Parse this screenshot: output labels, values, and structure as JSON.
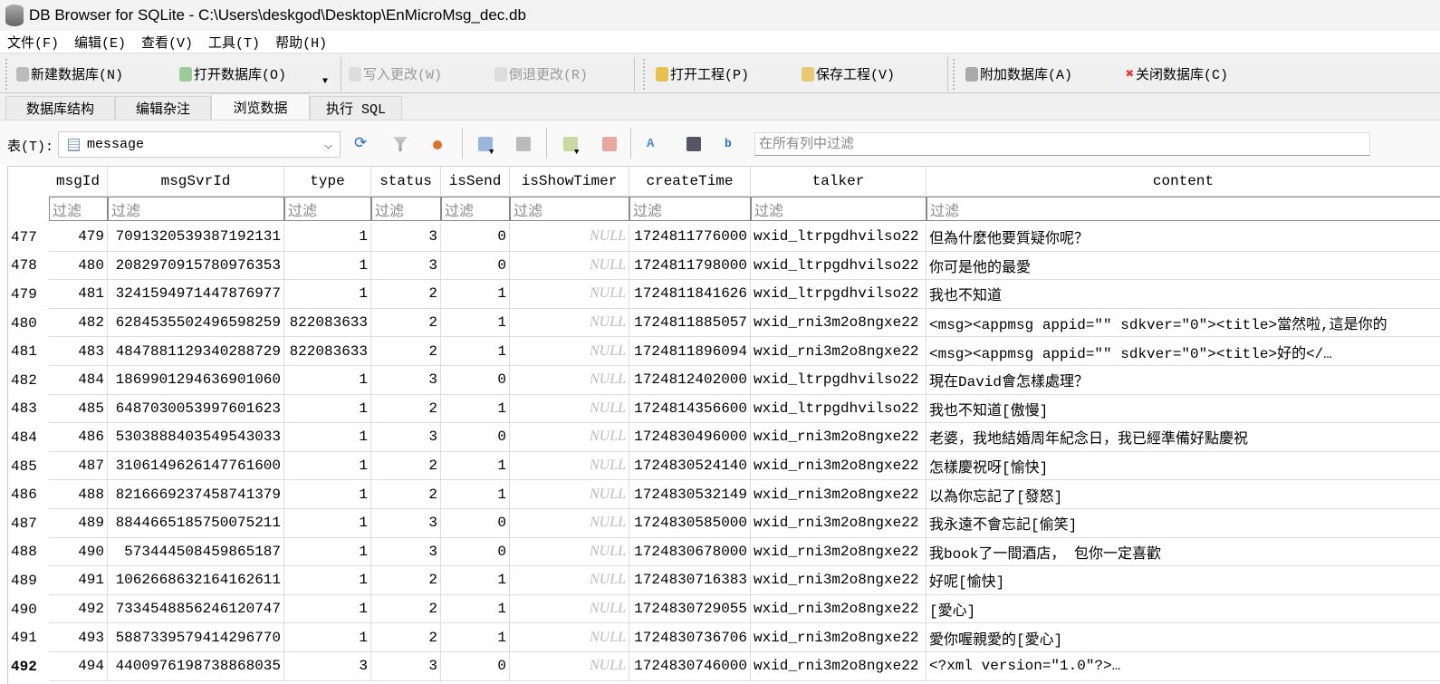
{
  "window": {
    "title": "DB Browser for SQLite - C:\\Users\\deskgod\\Desktop\\EnMicroMsg_dec.db"
  },
  "menu": [
    "文件(F)",
    "编辑(E)",
    "查看(V)",
    "工具(T)",
    "帮助(H)"
  ],
  "toolbar": {
    "new_db": "新建数据库(N)",
    "open_db": "打开数据库(O)",
    "write_changes": "写入更改(W)",
    "revert_changes": "倒退更改(R)",
    "open_project": "打开工程(P)",
    "save_project": "保存工程(V)",
    "attach_db": "附加数据库(A)",
    "close_db": "关闭数据库(C)"
  },
  "tabs": [
    "数据库结构",
    "编辑杂注",
    "浏览数据",
    "执行 SQL"
  ],
  "browse": {
    "table_label": "表(T):",
    "table_value": "message",
    "filter_all_placeholder": "在所有列中过滤"
  },
  "grid": {
    "columns": [
      "msgId",
      "msgSvrId",
      "type",
      "status",
      "isSend",
      "isShowTimer",
      "createTime",
      "talker",
      "content"
    ],
    "filter_placeholder": "过滤",
    "null_text": "NULL",
    "rows": [
      [
        "477",
        "479",
        "7091320539387192131",
        "1",
        "3",
        "0",
        "NULL",
        "1724811776000",
        "wxid_ltrpgdhvilso22",
        "但為什麼他要質疑你呢？"
      ],
      [
        "478",
        "480",
        "2082970915780976353",
        "1",
        "3",
        "0",
        "NULL",
        "1724811798000",
        "wxid_ltrpgdhvilso22",
        "你可是他的最愛"
      ],
      [
        "479",
        "481",
        "3241594971447876977",
        "1",
        "2",
        "1",
        "NULL",
        "1724811841626",
        "wxid_ltrpgdhvilso22",
        "我也不知道"
      ],
      [
        "480",
        "482",
        "6284535502496598259",
        "822083633",
        "2",
        "1",
        "NULL",
        "1724811885057",
        "wxid_rni3m2o8ngxe22",
        "<msg><appmsg appid=\"\" sdkver=\"0\"><title>當然啦,這是你的"
      ],
      [
        "481",
        "483",
        "4847881129340288729",
        "822083633",
        "2",
        "1",
        "NULL",
        "1724811896094",
        "wxid_rni3m2o8ngxe22",
        "<msg><appmsg appid=\"\" sdkver=\"0\"><title>好的</…"
      ],
      [
        "482",
        "484",
        "1869901294636901060",
        "1",
        "3",
        "0",
        "NULL",
        "1724812402000",
        "wxid_ltrpgdhvilso22",
        "現在David會怎樣處理？"
      ],
      [
        "483",
        "485",
        "6487030053997601623",
        "1",
        "2",
        "1",
        "NULL",
        "1724814356600",
        "wxid_ltrpgdhvilso22",
        "我也不知道[傲慢]"
      ],
      [
        "484",
        "486",
        "5303888403549543033",
        "1",
        "3",
        "0",
        "NULL",
        "1724830496000",
        "wxid_rni3m2o8ngxe22",
        "老婆，我地結婚周年紀念日，我已經準備好點慶祝"
      ],
      [
        "485",
        "487",
        "3106149626147761600",
        "1",
        "2",
        "1",
        "NULL",
        "1724830524140",
        "wxid_rni3m2o8ngxe22",
        "怎樣慶祝呀[愉快]"
      ],
      [
        "486",
        "488",
        "8216669237458741379",
        "1",
        "2",
        "1",
        "NULL",
        "1724830532149",
        "wxid_rni3m2o8ngxe22",
        "以為你忘記了[發怒]"
      ],
      [
        "487",
        "489",
        "8844665185750075211",
        "1",
        "3",
        "0",
        "NULL",
        "1724830585000",
        "wxid_rni3m2o8ngxe22",
        "我永遠不會忘記[偷笑]"
      ],
      [
        "488",
        "490",
        "573444508459865187",
        "1",
        "3",
        "0",
        "NULL",
        "1724830678000",
        "wxid_rni3m2o8ngxe22",
        "我book了一間酒店， 包你一定喜歡"
      ],
      [
        "489",
        "491",
        "1062668632164162611",
        "1",
        "2",
        "1",
        "NULL",
        "1724830716383",
        "wxid_rni3m2o8ngxe22",
        "好呢[愉快]"
      ],
      [
        "490",
        "492",
        "7334548856246120747",
        "1",
        "2",
        "1",
        "NULL",
        "1724830729055",
        "wxid_rni3m2o8ngxe22",
        "[愛心]"
      ],
      [
        "491",
        "493",
        "5887339579414296770",
        "1",
        "2",
        "1",
        "NULL",
        "1724830736706",
        "wxid_rni3m2o8ngxe22",
        "愛你喔親愛的[愛心]"
      ],
      [
        "492",
        "494",
        "4400976198738868035",
        "3",
        "3",
        "0",
        "NULL",
        "1724830746000",
        "wxid_rni3m2o8ngxe22",
        "<?xml version=\"1.0\"?>…"
      ]
    ]
  }
}
